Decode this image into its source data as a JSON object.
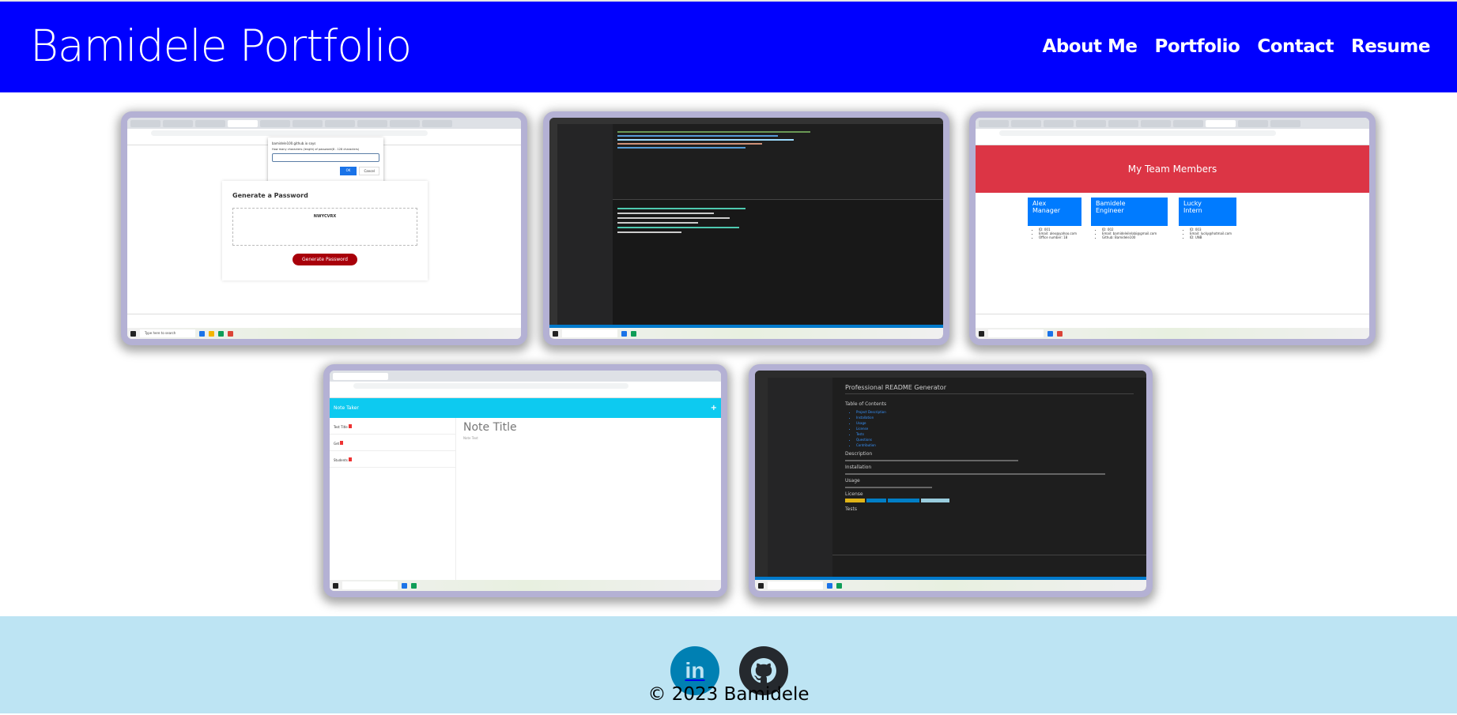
{
  "header": {
    "title": "Bamidele Portfolio",
    "nav": [
      "About Me",
      "Portfolio",
      "Contact",
      "Resume"
    ]
  },
  "colors": {
    "header_bg": "#0000ff",
    "footer_bg": "#bde4f3",
    "card_border": "#b4b1d4",
    "linkedin": "#0080b3",
    "github": "#25292e"
  },
  "portfolio": {
    "password": {
      "dialog_title": "bamidele100.github.io says",
      "dialog_text": "How many characters (length) of password(8 - 128 characters)",
      "ok": "OK",
      "cancel": "Cancel",
      "heading": "Generate a Password",
      "output": "NWYCVRX",
      "button": "Generate Password",
      "taskbar_search": "Type here to search"
    },
    "team": {
      "banner": "My Team Members",
      "members": [
        {
          "name": "Alex",
          "role": "Manager",
          "details": [
            "ID: 001",
            "Email: alex@yahoo.com",
            "Office number: 18"
          ]
        },
        {
          "name": "Bamidele",
          "role": "Engineer",
          "details": [
            "ID: 002",
            "Email: bamideleilelabi@gmail.com",
            "Github: Bamidele100"
          ]
        },
        {
          "name": "Lucky",
          "role": "Intern",
          "details": [
            "ID: 003",
            "Email: lucky@hotmail.com",
            "ID: UNB"
          ]
        }
      ]
    },
    "notes": {
      "app_title": "Note Taker",
      "items": [
        "Test Title",
        "Get",
        "Students"
      ],
      "note_title": "Note Title",
      "note_text": "Note Text"
    },
    "readme": {
      "heading": "Professional README Generator",
      "toc_title": "Table of Contents",
      "toc": [
        "Project Description",
        "Installation",
        "Usage",
        "License",
        "Tests",
        "Questions",
        "Contribution"
      ],
      "sections": [
        "Description",
        "Installation",
        "Usage",
        "License",
        "Tests"
      ]
    }
  },
  "footer": {
    "copyright": "© 2023 Bamidele",
    "links": [
      "linkedin",
      "github"
    ]
  }
}
